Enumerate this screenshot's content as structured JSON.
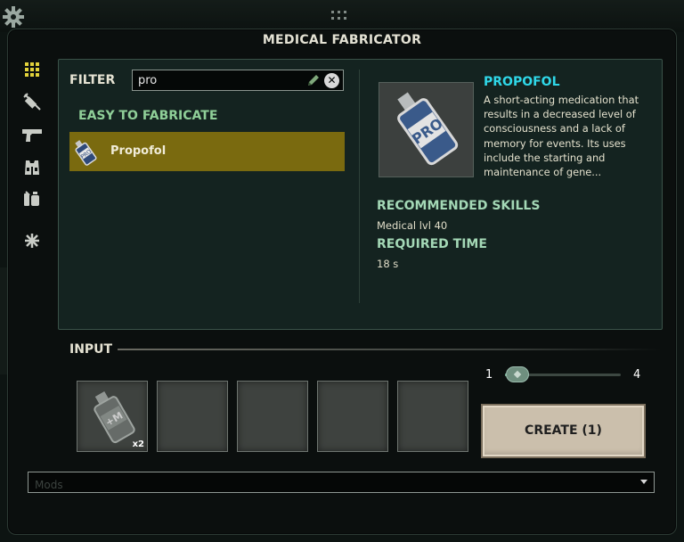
{
  "window": {
    "title": "MEDICAL FABRICATOR"
  },
  "side_tabs": [
    {
      "icon": "grid-icon",
      "active": true
    },
    {
      "icon": "syringe-icon"
    },
    {
      "icon": "pistol-icon"
    },
    {
      "icon": "armor-vest-icon"
    },
    {
      "icon": "chemicals-icon"
    },
    {
      "icon": "asterisk-icon"
    }
  ],
  "filter": {
    "label": "FILTER",
    "value": "pro"
  },
  "recipe_list": {
    "section_title": "EASY TO FABRICATE",
    "items": [
      {
        "label": "Propofol",
        "selected": true
      }
    ]
  },
  "detail": {
    "name": "PROPOFOL",
    "description": "A short-acting medication that results in a decreased level of consciousness and a lack of memory for events. Its uses include the starting and maintenance of gene...",
    "recommended_skills_title": "RECOMMENDED SKILLS",
    "recommended_skills_value": "Medical lvl 40",
    "required_time_title": "REQUIRED TIME",
    "required_time_value": "18 s"
  },
  "input": {
    "label": "INPUT",
    "slots": [
      {
        "filled": true,
        "count": "x2"
      },
      {
        "filled": false
      },
      {
        "filled": false
      },
      {
        "filled": false
      },
      {
        "filled": false
      }
    ]
  },
  "quantity": {
    "min": "1",
    "max": "4",
    "value": 1
  },
  "create_button": {
    "label": "CREATE (1)"
  },
  "mods": {
    "placeholder": "Mods"
  },
  "colors": {
    "selected_row": "#7a6a0f",
    "item_name": "#2fd7e8",
    "section_heading": "#8fcf98",
    "panel_bg": "#142320"
  }
}
